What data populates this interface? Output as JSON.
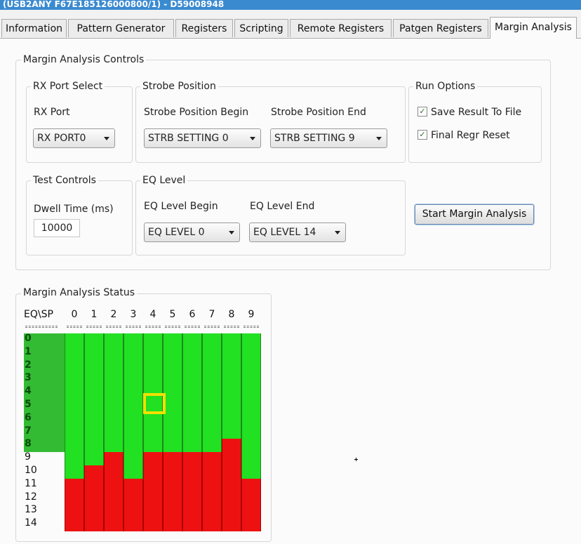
{
  "window": {
    "title": "(USB2ANY F67E185126000800/1) - D59008948"
  },
  "tabs": [
    {
      "label": "Information",
      "active": false
    },
    {
      "label": "Pattern Generator",
      "active": false
    },
    {
      "label": "Registers",
      "active": false
    },
    {
      "label": "Scripting",
      "active": false
    },
    {
      "label": "Remote Registers",
      "active": false
    },
    {
      "label": "Patgen Registers",
      "active": false
    },
    {
      "label": "Margin Analysis",
      "active": true
    }
  ],
  "controls": {
    "title": "Margin Analysis Controls",
    "rx_port_select": {
      "title": "RX Port Select",
      "label": "RX Port",
      "value": "RX PORT0"
    },
    "strobe_position": {
      "title": "Strobe Position",
      "begin_label": "Strobe Position Begin",
      "begin_value": "STRB SETTING 0",
      "end_label": "Strobe Position End",
      "end_value": "STRB SETTING 9"
    },
    "run_options": {
      "title": "Run Options",
      "save_result": {
        "label": "Save Result To File",
        "checked": true
      },
      "final_regr_reset": {
        "label": "Final Regr Reset",
        "checked": true
      }
    },
    "test_controls": {
      "title": "Test Controls",
      "dwell_label": "Dwell Time (ms)",
      "dwell_value": "10000"
    },
    "eq_level": {
      "title": "EQ Level",
      "begin_label": "EQ Level Begin",
      "begin_value": "EQ LEVEL 0",
      "end_label": "EQ Level End",
      "end_value": "EQ LEVEL 14"
    },
    "start_button": "Start Margin Analysis"
  },
  "status": {
    "title": "Margin Analysis Status",
    "corner_label": "EQ\\SP",
    "sp_columns": [
      "0",
      "1",
      "2",
      "3",
      "4",
      "5",
      "6",
      "7",
      "8",
      "9"
    ],
    "eq_rows": [
      "0",
      "1",
      "2",
      "3",
      "4",
      "5",
      "6",
      "7",
      "8",
      "9",
      "10",
      "11",
      "12",
      "13",
      "14"
    ],
    "eq_range_highlight_last": 8,
    "first_fail_eq_per_sp": [
      11,
      10,
      9,
      11,
      9,
      9,
      9,
      9,
      8,
      11
    ],
    "selected_cell": {
      "sp": 4,
      "eq": 5
    },
    "colors": {
      "pass": "#22e022",
      "fail": "#ee1111",
      "eq_highlight": "#33bb33",
      "selection": "#f2e000"
    }
  }
}
